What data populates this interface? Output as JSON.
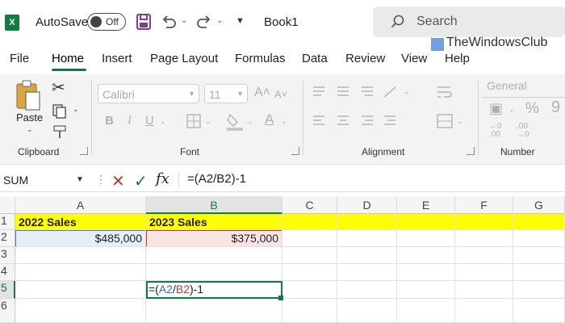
{
  "titlebar": {
    "logo": "X",
    "autosave_label": "AutoSave",
    "autosave_state": "Off",
    "doc_title": "Book1",
    "search_placeholder": "Search",
    "watermark": "TheWindowsClub"
  },
  "menu": {
    "items": [
      "File",
      "Home",
      "Insert",
      "Page Layout",
      "Formulas",
      "Data",
      "Review",
      "View",
      "Help"
    ],
    "active": "Home"
  },
  "ribbon": {
    "clipboard": {
      "label": "Clipboard",
      "paste_label": "Paste"
    },
    "font": {
      "label": "Font",
      "font_name": "Calibri",
      "font_size": "11"
    },
    "alignment": {
      "label": "Alignment"
    },
    "number": {
      "label": "Number",
      "format": "General"
    }
  },
  "formula_bar": {
    "name_box": "SUM",
    "fx": "fx",
    "formula": "=(A2/B2)-1"
  },
  "sheet": {
    "columns": [
      "A",
      "B",
      "C",
      "D",
      "E",
      "F",
      "G"
    ],
    "rows": [
      "1",
      "2",
      "3",
      "4",
      "5",
      "6"
    ],
    "cells": {
      "A1": "2022 Sales",
      "B1": "2023 Sales",
      "A2": "$485,000",
      "B2": "$375,000",
      "B5_prefix": "=(",
      "B5_ref1": "A2",
      "B5_slash": "/",
      "B5_ref2": "B2",
      "B5_suffix": ")-1"
    },
    "highlight_color": "#ffff00",
    "accent": "#107c41"
  }
}
